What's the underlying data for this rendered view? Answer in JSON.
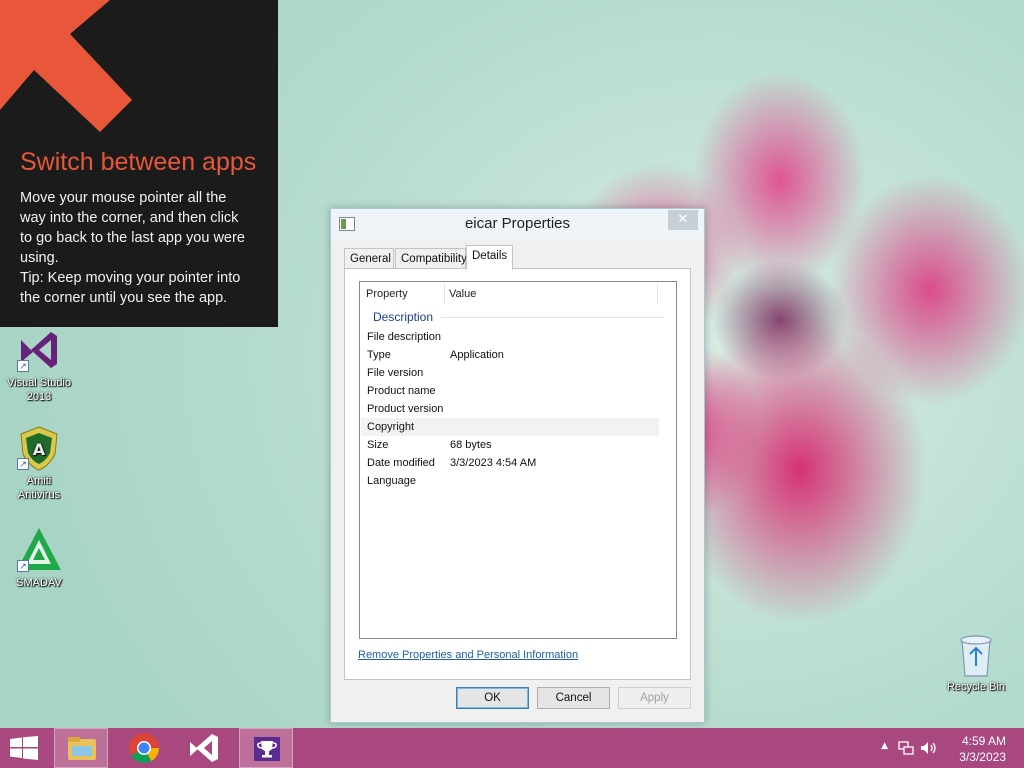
{
  "tip": {
    "title": "Switch between apps",
    "body_lines": [
      "Move your mouse pointer all the",
      "way into the corner, and then click",
      "to go back to the last app you were",
      "using.",
      "Tip: Keep moving your pointer into",
      "the corner until you see the app."
    ],
    "accent_color": "#e8573a"
  },
  "desktop_icons": [
    {
      "label_line1": "Visual Studio",
      "label_line2": "2013",
      "icon": "visual-studio-icon"
    },
    {
      "label_line1": "Amiti",
      "label_line2": "Antivirus",
      "icon": "amiti-antivirus-icon"
    },
    {
      "label_line1": "SMADAV",
      "label_line2": "",
      "icon": "smadav-icon"
    }
  ],
  "recycle_bin": {
    "label": "Recycle Bin",
    "icon": "recycle-bin-icon"
  },
  "dialog": {
    "title": "eicar Properties",
    "close_glyph": "✕",
    "tabs": [
      "General",
      "Compatibility",
      "Details"
    ],
    "active_tab": "Details",
    "columns": {
      "property": "Property",
      "value": "Value"
    },
    "group": "Description",
    "rows": [
      {
        "key": "File description",
        "value": ""
      },
      {
        "key": "Type",
        "value": "Application"
      },
      {
        "key": "File version",
        "value": ""
      },
      {
        "key": "Product name",
        "value": ""
      },
      {
        "key": "Product version",
        "value": ""
      },
      {
        "key": "Copyright",
        "value": ""
      },
      {
        "key": "Size",
        "value": "68 bytes"
      },
      {
        "key": "Date modified",
        "value": "3/3/2023 4:54 AM"
      },
      {
        "key": "Language",
        "value": ""
      }
    ],
    "remove_link": "Remove Properties and Personal Information",
    "buttons": {
      "ok": "OK",
      "cancel": "Cancel",
      "apply": "Apply"
    }
  },
  "taskbar": {
    "color": "#a9487e",
    "apps": [
      "file-explorer-icon",
      "chrome-icon",
      "visual-studio-icon",
      "trophy-app-icon"
    ],
    "clock": {
      "time": "4:59 AM",
      "date": "3/3/2023"
    }
  }
}
